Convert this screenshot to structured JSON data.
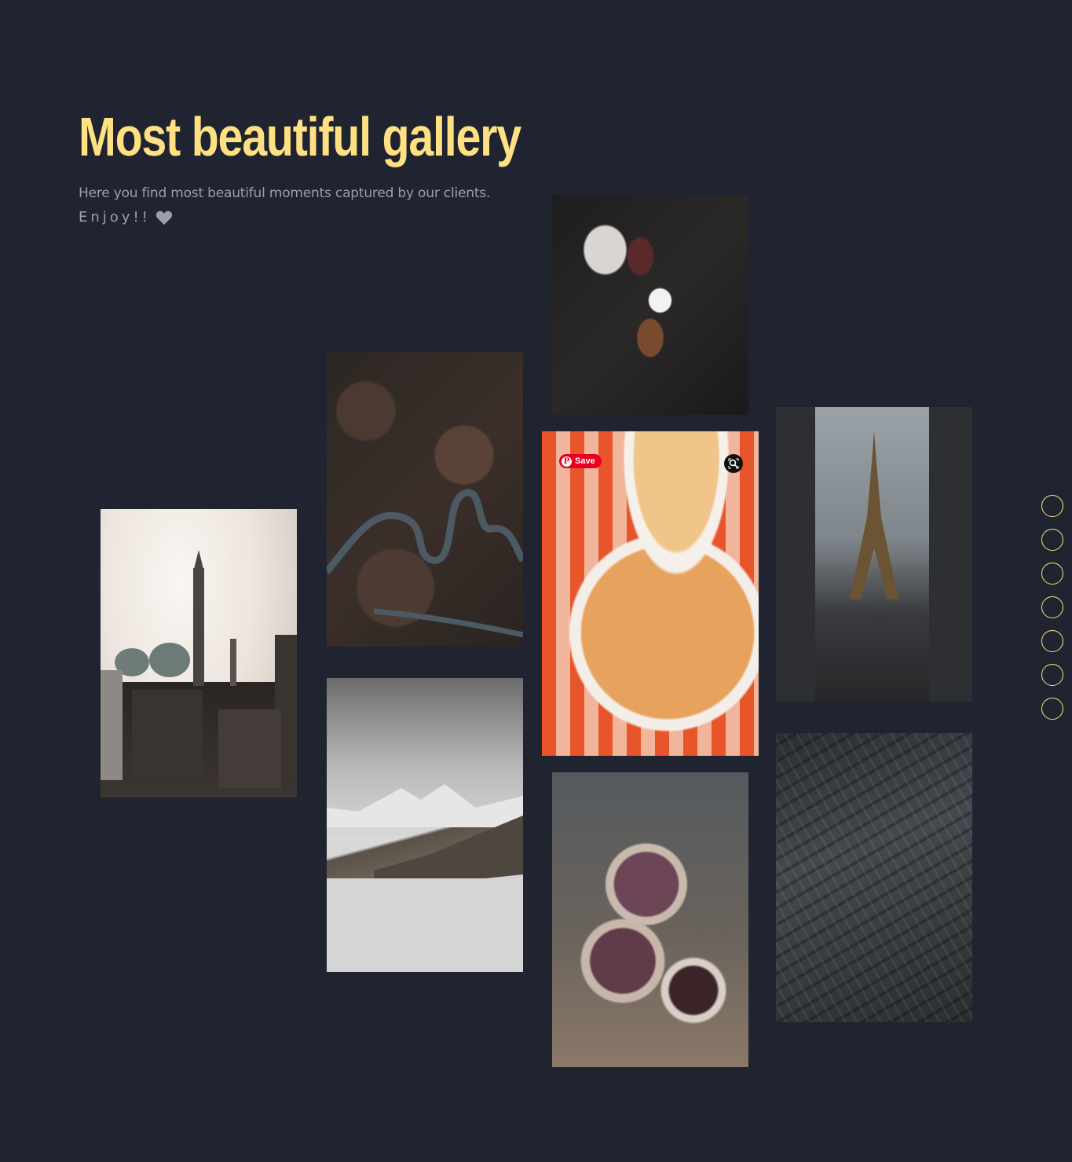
{
  "header": {
    "title": "Most beautiful gallery",
    "subtitle": "Here you find most beautiful moments captured by our clients.",
    "enjoy": "Enjoy!!",
    "heart_icon": "heart-icon"
  },
  "colors": {
    "background": "#1f2430",
    "title": "#ffe082",
    "text": "#9aa0ab",
    "dot_border": "#ffe082",
    "pinterest_red": "#e60023"
  },
  "gallery": {
    "pinterest": {
      "save_label": "Save",
      "pin_icon": "pinterest-icon",
      "lens_icon": "visual-search-icon"
    },
    "images": [
      {
        "name": "mosque-skyline-photo"
      },
      {
        "name": "winding-forest-road-photo"
      },
      {
        "name": "snowy-mountain-clouds-photo"
      },
      {
        "name": "spices-spoons-photo"
      },
      {
        "name": "pizza-checkered-tablecloth-photo"
      },
      {
        "name": "berry-bowls-photo"
      },
      {
        "name": "eiffel-tower-street-photo"
      },
      {
        "name": "aerial-city-night-photo"
      }
    ]
  },
  "pagination": {
    "dot_count": 7
  }
}
